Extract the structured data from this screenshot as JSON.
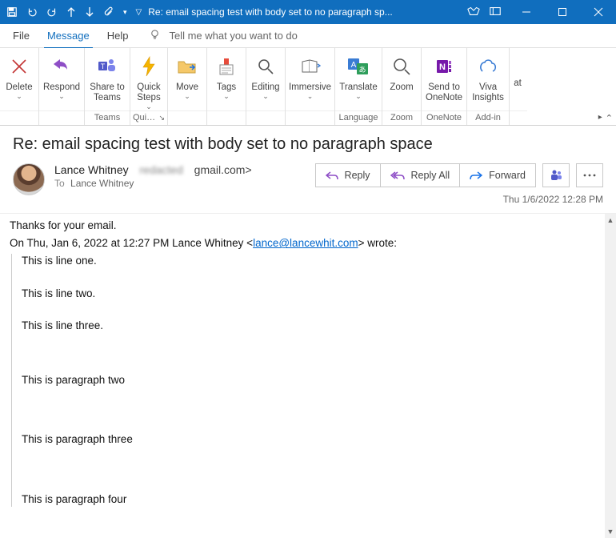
{
  "window": {
    "title": "Re: email spacing test with body set to no paragraph sp..."
  },
  "menu": {
    "file": "File",
    "message": "Message",
    "help": "Help",
    "tell_me": "Tell me what you want to do"
  },
  "ribbon": {
    "delete": "Delete",
    "respond": "Respond",
    "share_teams": "Share to\nTeams",
    "quick_steps": "Quick\nSteps",
    "move": "Move",
    "tags": "Tags",
    "editing": "Editing",
    "immersive": "Immersive",
    "translate": "Translate",
    "zoom": "Zoom",
    "send_onenote": "Send to\nOneNote",
    "viva": "Viva\nInsights",
    "overflow": "at",
    "groups": {
      "teams": "Teams",
      "quick": "Qui…",
      "language": "Language",
      "zoom": "Zoom",
      "onenote": "OneNote",
      "addin": "Add-in"
    }
  },
  "email": {
    "subject": "Re: email spacing test with body set to no paragraph space",
    "sender_name": "Lance Whitney",
    "sender_email_suffix": "gmail.com>",
    "to_label": "To",
    "to_value": "Lance Whitney",
    "timestamp": "Thu 1/6/2022 12:28 PM",
    "body_thanks": "Thanks for your email.",
    "quote_intro_prefix": "On Thu, Jan 6, 2022 at 12:27 PM Lance Whitney <",
    "quote_intro_link": "lance@lancewhit.com",
    "quote_intro_suffix": "> wrote:",
    "lines": [
      "This is line one.",
      "This is line two.",
      "This is line three."
    ],
    "paras": [
      "This is paragraph two",
      "This is paragraph three",
      "This is paragraph four"
    ]
  },
  "actions": {
    "reply": "Reply",
    "reply_all": "Reply All",
    "forward": "Forward"
  }
}
